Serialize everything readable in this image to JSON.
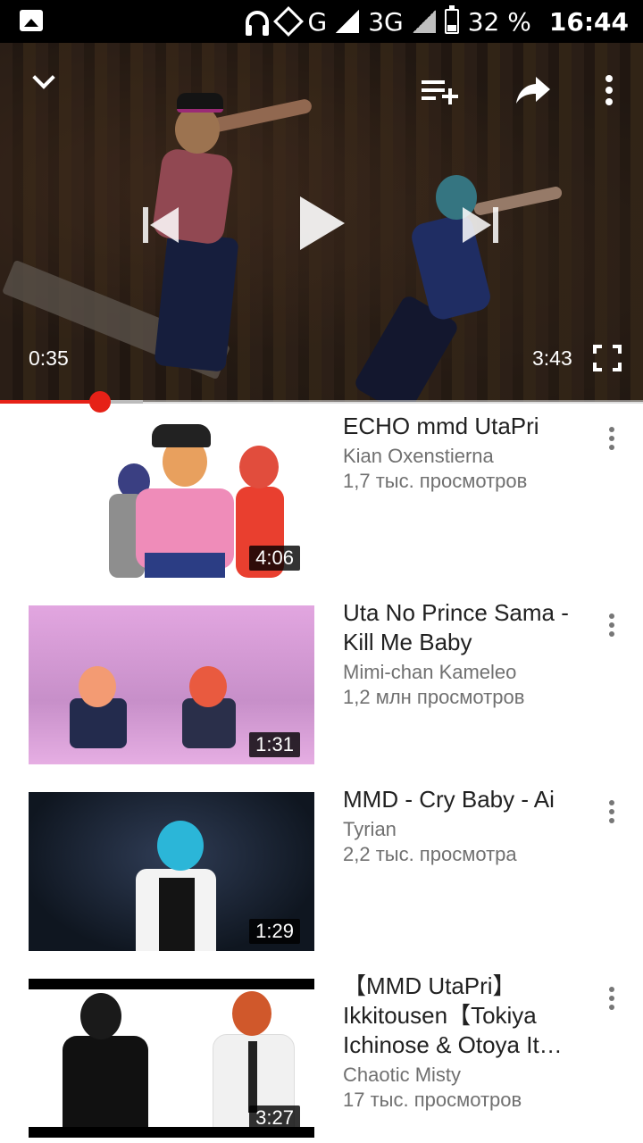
{
  "status_bar": {
    "network_label": "G",
    "network2_label": "3G",
    "battery_text": "32 %",
    "time": "16:44"
  },
  "player": {
    "current_time": "0:35",
    "duration": "3:43",
    "progress_fraction": 0.156,
    "buffered_fraction": 0.222
  },
  "videos": [
    {
      "title": "ECHO mmd UtaPri",
      "channel": "Kian Oxenstierna",
      "views": "1,7 тыс. просмотров",
      "duration": "4:06"
    },
    {
      "title": "Uta No Prince Sama - Kill Me Baby",
      "channel": "Mimi-chan Kameleo",
      "views": "1,2 млн просмотров",
      "duration": "1:31"
    },
    {
      "title": "MMD - Cry Baby - Ai",
      "channel": "Tyrian",
      "views": "2,2 тыс. просмотра",
      "duration": "1:29"
    },
    {
      "title": "【MMD UtaPri】Ikkitousen【Tokiya Ichinose & Otoya It…",
      "channel": "Chaotic Misty",
      "views": "17 тыс. просмотров",
      "duration": "3:27"
    }
  ],
  "colors": {
    "accent": "#e62117",
    "text_primary": "#212121",
    "text_secondary": "#707070"
  },
  "icons": {
    "gallery": "gallery-icon",
    "headphones": "headphones-icon",
    "collapse": "chevron-down-icon",
    "add_to_queue": "playlist-add-icon",
    "share": "share-icon",
    "more": "more-vert-icon",
    "previous": "skip-previous-icon",
    "play": "play-icon",
    "next": "skip-next-icon",
    "fullscreen": "fullscreen-icon"
  }
}
